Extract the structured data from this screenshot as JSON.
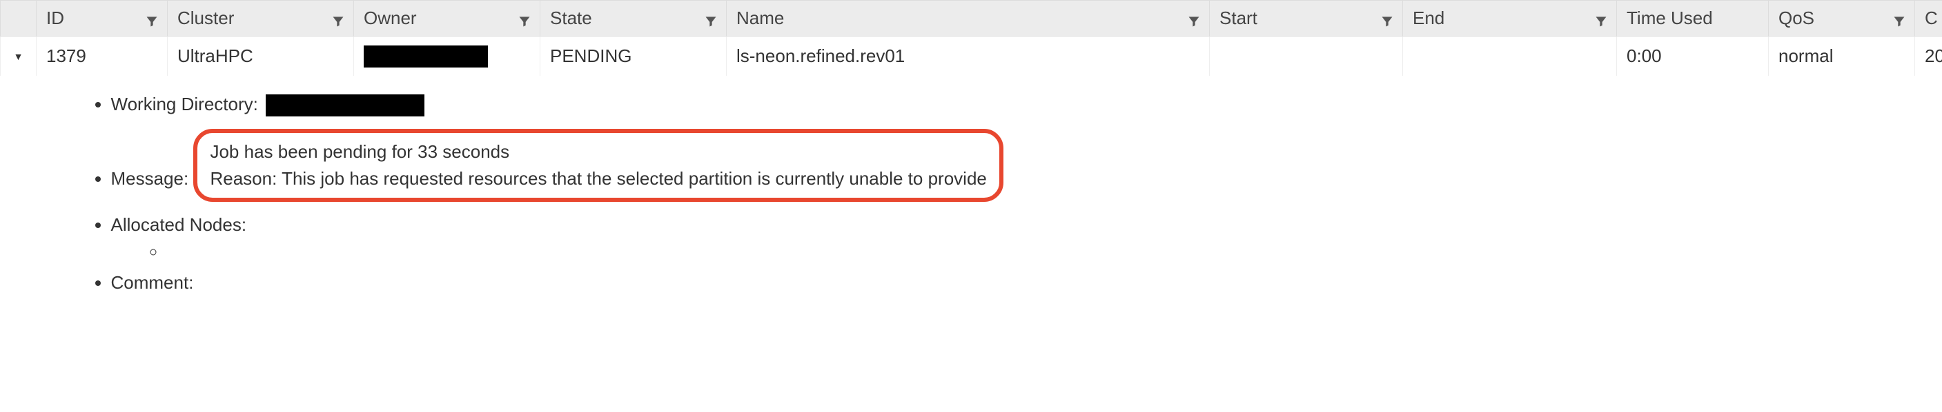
{
  "columns": {
    "id": "ID",
    "cluster": "Cluster",
    "owner": "Owner",
    "state": "State",
    "name": "Name",
    "start": "Start",
    "end": "End",
    "timeused": "Time Used",
    "qos": "QoS",
    "extra": "C"
  },
  "row": {
    "id": "1379",
    "cluster": "UltraHPC",
    "owner": "",
    "state": "PENDING",
    "name": "ls-neon.refined.rev01",
    "start": "",
    "end": "",
    "timeused": "0:00",
    "qos": "normal",
    "extra": "20"
  },
  "details": {
    "working_directory_label": "Working Directory:",
    "message_label": "Message:",
    "message_line1": "Job has been pending for 33 seconds",
    "message_line2": "Reason: This job has requested resources that the selected partition is currently unable to provide",
    "allocated_nodes_label": "Allocated Nodes:",
    "comment_label": "Comment:"
  }
}
